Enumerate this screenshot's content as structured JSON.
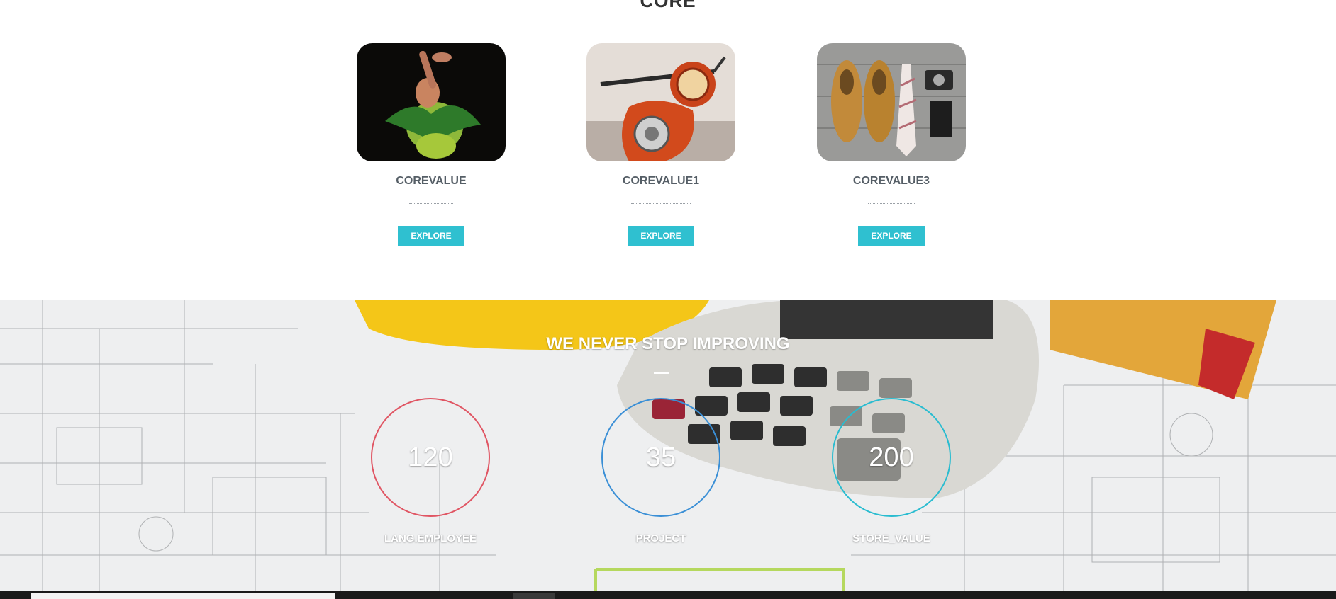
{
  "section": {
    "title": "CORE"
  },
  "cards": [
    {
      "title": "COREVALUE",
      "button": "EXPLORE",
      "image": "dancer-photo"
    },
    {
      "title": "COREVALUE1",
      "button": "EXPLORE",
      "image": "scooter-photo"
    },
    {
      "title": "COREVALUE3",
      "button": "EXPLORE",
      "image": "shoes-tie-photo"
    }
  ],
  "stats": {
    "title": "WE NEVER STOP IMPROVING",
    "items": [
      {
        "value": "120",
        "label": "LANG.EMPLOYEE",
        "color": "#e05563"
      },
      {
        "value": "35",
        "label": "PROJECT",
        "color": "#3a8fd6"
      },
      {
        "value": "200",
        "label": "STORE_VALUE",
        "color": "#29bcd0"
      }
    ]
  },
  "colors": {
    "accent": "#2fc0d0"
  }
}
